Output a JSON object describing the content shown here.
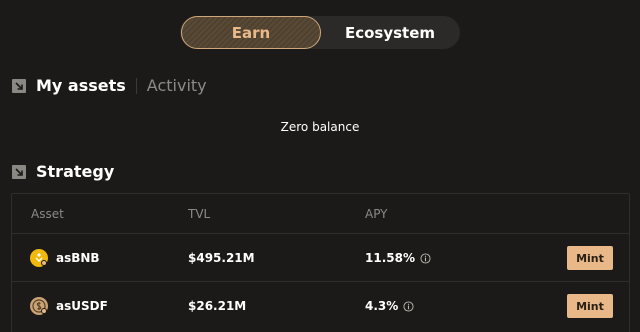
{
  "tabs": {
    "earn": "Earn",
    "ecosystem": "Ecosystem"
  },
  "my_assets": {
    "title": "My assets",
    "activity_tab": "Activity",
    "empty_text": "Zero balance"
  },
  "strategy": {
    "title": "Strategy",
    "columns": {
      "asset": "Asset",
      "tvl": "TVL",
      "apy": "APY"
    },
    "rows": [
      {
        "asset": "asBNB",
        "icon": "bnb-token-icon",
        "tvl": "$495.21M",
        "apy": "11.58%",
        "action": "Mint"
      },
      {
        "asset": "asUSDF",
        "icon": "usdf-token-icon",
        "tvl": "$26.21M",
        "apy": "4.3%",
        "action": "Mint"
      }
    ]
  },
  "colors": {
    "background": "#1b1a19",
    "accent": "#e8b889",
    "bnb": "#f0b90b"
  }
}
